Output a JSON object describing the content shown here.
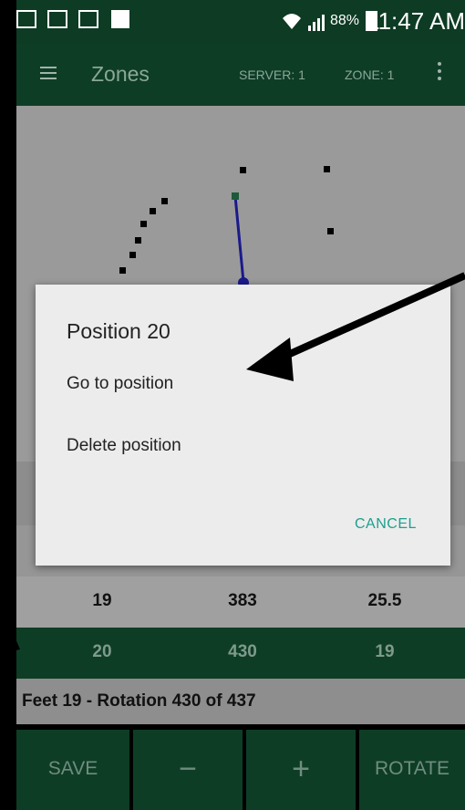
{
  "status_bar": {
    "battery": "88%",
    "time": "11:47 AM"
  },
  "toolbar": {
    "title": "Zones",
    "server": "SERVER: 1",
    "zone": "ZONE: 1"
  },
  "dialog": {
    "title": "Position 20",
    "options": [
      "Go to position",
      "Delete position"
    ],
    "cancel_label": "CANCEL"
  },
  "rows": [
    {
      "feet": "19",
      "rotation": "383",
      "value": "25.5"
    },
    {
      "feet": "20",
      "rotation": "430",
      "value": "19"
    }
  ],
  "info": {
    "text": "Feet 19 - Rotation 430 of 437"
  },
  "buttons": {
    "save": "SAVE",
    "minus": "−",
    "plus": "+",
    "rotate": "ROTATE"
  },
  "colors": {
    "primary_dark": "#0e3d25",
    "accent": "#1d9f8d",
    "line": "#1a1a8c"
  }
}
